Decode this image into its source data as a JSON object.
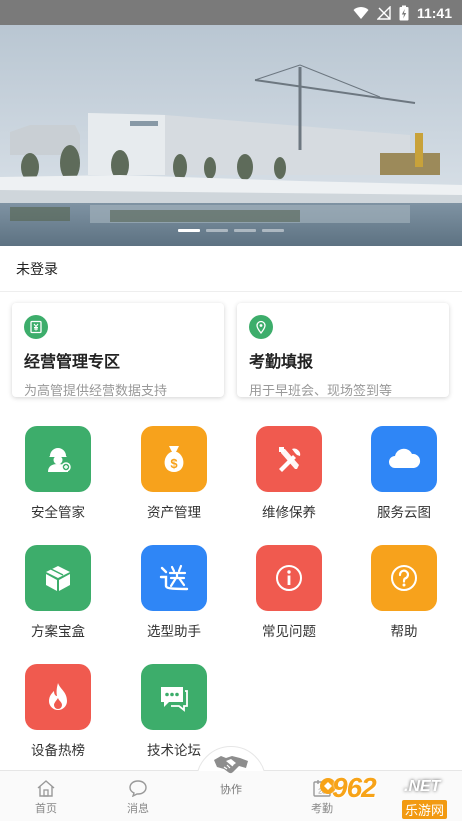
{
  "status_bar": {
    "time": "11:41"
  },
  "login": {
    "text": "未登录"
  },
  "cards": [
    {
      "title": "经营管理专区",
      "desc": "为高管提供经营数据支持",
      "icon": "yuan-document-icon"
    },
    {
      "title": "考勤填报",
      "desc": "用于早班会、现场签到等",
      "icon": "location-pin-icon"
    }
  ],
  "grid": [
    {
      "label": "安全管家",
      "color": "#3dad6b",
      "icon": "worker-helmet-icon"
    },
    {
      "label": "资产管理",
      "color": "#f7a21c",
      "icon": "money-bag-icon"
    },
    {
      "label": "维修保养",
      "color": "#f05a4f",
      "icon": "tools-icon"
    },
    {
      "label": "服务云图",
      "color": "#2f86f6",
      "icon": "cloud-icon"
    },
    {
      "label": "方案宝盒",
      "color": "#3dad6b",
      "icon": "box-icon"
    },
    {
      "label": "选型助手",
      "color": "#2f86f6",
      "icon": "select-character-icon"
    },
    {
      "label": "常见问题",
      "color": "#f05a4f",
      "icon": "info-icon"
    },
    {
      "label": "帮助",
      "color": "#f7a21c",
      "icon": "question-icon"
    },
    {
      "label": "设备热榜",
      "color": "#f05a4f",
      "icon": "flame-icon"
    },
    {
      "label": "技术论坛",
      "color": "#3dad6b",
      "icon": "chat-icon"
    }
  ],
  "tabs": [
    {
      "label": "首页",
      "icon": "home-icon"
    },
    {
      "label": "消息",
      "icon": "message-icon"
    },
    {
      "label": "协作",
      "icon": "handshake-icon"
    },
    {
      "label": "考勤",
      "icon": "calendar-icon"
    }
  ],
  "watermark": {
    "number": "962",
    "net": ".NET",
    "sub": "乐游网"
  }
}
